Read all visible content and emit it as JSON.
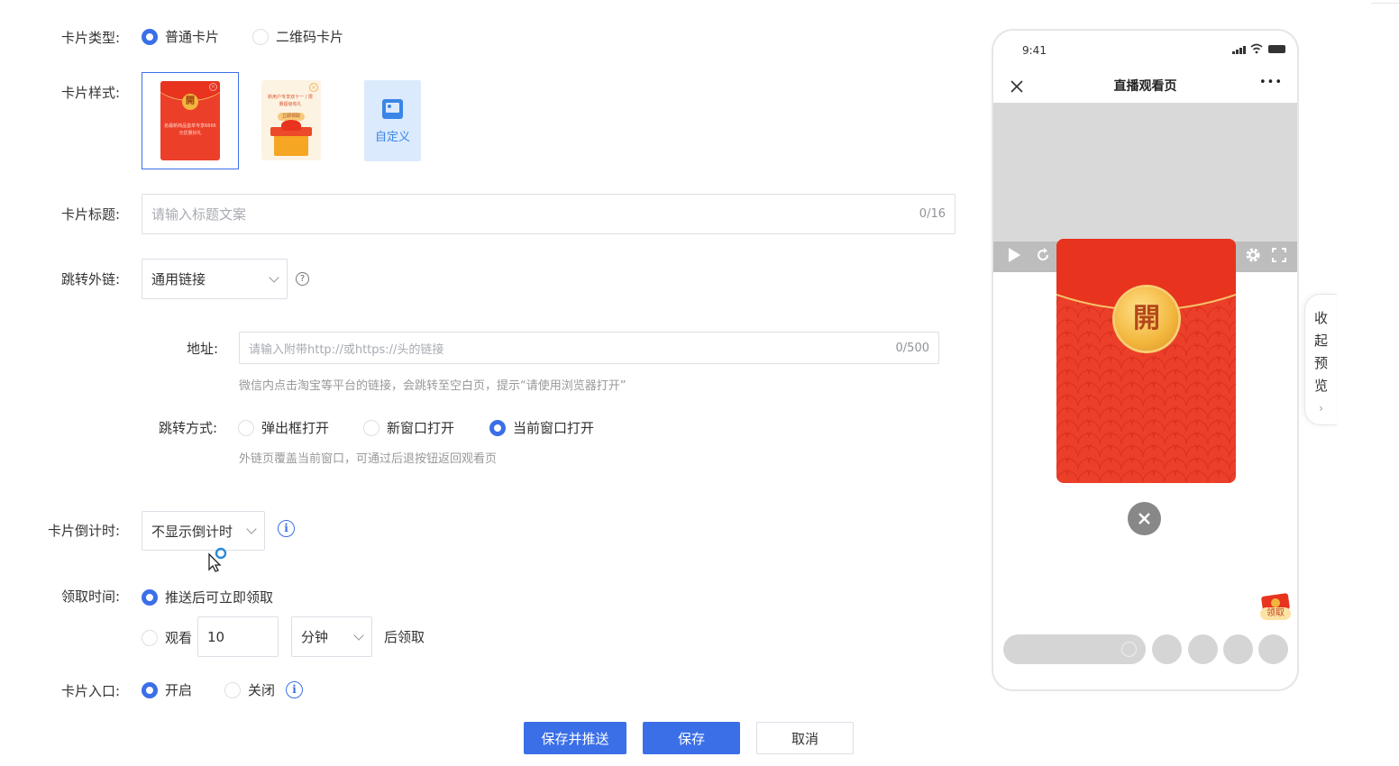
{
  "form": {
    "card_type": {
      "label": "卡片类型:",
      "options": [
        "普通卡片",
        "二维码卡片"
      ],
      "selected": "普通卡片"
    },
    "card_style": {
      "label": "卡片样式:",
      "redpacket_char": "開",
      "redpacket_text": "抢最新商品首单专享6666元优惠好礼",
      "gift_text": "新用户专享双十一 / 限量超级有礼",
      "gift_button": "立即领取",
      "custom_label": "自定义"
    },
    "card_title": {
      "label": "卡片标题:",
      "placeholder": "请输入标题文案",
      "counter": "0/16"
    },
    "jump_link": {
      "label": "跳转外链:",
      "value": "通用链接",
      "help": "?"
    },
    "address": {
      "label": "地址:",
      "placeholder": "请输入附带http://或https://头的链接",
      "counter": "0/500",
      "hint": "微信内点击淘宝等平台的链接，会跳转至空白页，提示“请使用浏览器打开”"
    },
    "jump_mode": {
      "label": "跳转方式:",
      "options": [
        "弹出框打开",
        "新窗口打开",
        "当前窗口打开"
      ],
      "selected": "当前窗口打开",
      "hint": "外链页覆盖当前窗口，可通过后退按钮返回观看页"
    },
    "countdown": {
      "label": "卡片倒计时:",
      "value": "不显示倒计时",
      "info": "i"
    },
    "receive_time": {
      "label": "领取时间:",
      "option1": "推送后可立即领取",
      "option2_prefix": "观看",
      "option2_value": "10",
      "option2_unit": "分钟",
      "option2_suffix": "后领取",
      "selected": "推送后可立即领取"
    },
    "card_entry": {
      "label": "卡片入口:",
      "options": [
        "开启",
        "关闭"
      ],
      "selected": "开启",
      "info": "i"
    }
  },
  "buttons": {
    "save_push": "保存并推送",
    "save": "保存",
    "cancel": "取消"
  },
  "preview": {
    "time": "9:41",
    "title": "直播观看页",
    "redpacket_char": "開",
    "gift_badge": "领取",
    "menu_glyph": "•••"
  },
  "side_tab": {
    "chars": [
      "收",
      "起",
      "预",
      "览"
    ],
    "arrow": "›"
  },
  "colors": {
    "primary": "#3b6fe8",
    "redpacket": "#ec3f2a",
    "gold": "#f2b63c"
  }
}
